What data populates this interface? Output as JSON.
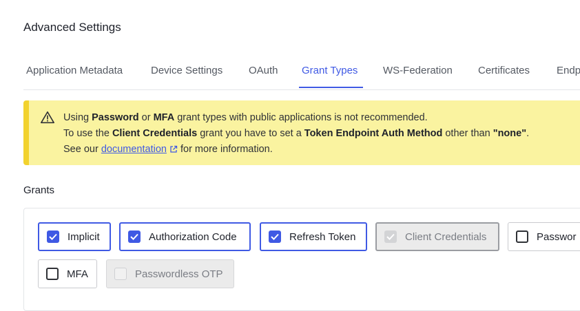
{
  "page": {
    "title": "Advanced Settings"
  },
  "tabs": [
    {
      "label": "Application Metadata",
      "active": false
    },
    {
      "label": "Device Settings",
      "active": false
    },
    {
      "label": "OAuth",
      "active": false
    },
    {
      "label": "Grant Types",
      "active": true
    },
    {
      "label": "WS-Federation",
      "active": false
    },
    {
      "label": "Certificates",
      "active": false
    },
    {
      "label": "Endp",
      "active": false
    }
  ],
  "warning": {
    "icon": "warning-triangle-icon",
    "line1": {
      "t1": "Using ",
      "b1": "Password",
      "t2": " or ",
      "b2": "MFA",
      "t3": " grant types with public applications is not recommended."
    },
    "line2": {
      "t1": "To use the ",
      "b1": "Client Credentials",
      "t2": " grant you have to set a ",
      "b2": "Token Endpoint Auth Method",
      "t3": " other than ",
      "b3": "\"none\"",
      "t4": "."
    },
    "line3": {
      "t1": "See our ",
      "link": "documentation",
      "t2": " for more information."
    }
  },
  "grants": {
    "label": "Grants",
    "items": [
      {
        "label": "Implicit",
        "checked": true,
        "disabled": false
      },
      {
        "label": "Authorization Code",
        "checked": true,
        "disabled": false
      },
      {
        "label": "Refresh Token",
        "checked": true,
        "disabled": false
      },
      {
        "label": "Client Credentials",
        "checked": true,
        "disabled": true
      },
      {
        "label": "Passwor",
        "checked": false,
        "disabled": false
      },
      {
        "label": "MFA",
        "checked": false,
        "disabled": false
      },
      {
        "label": "Passwordless OTP",
        "checked": false,
        "disabled": true
      }
    ]
  },
  "colors": {
    "accent": "#3f59e4",
    "warning_bg": "#faf3a0",
    "warning_bar": "#f2d22e"
  }
}
